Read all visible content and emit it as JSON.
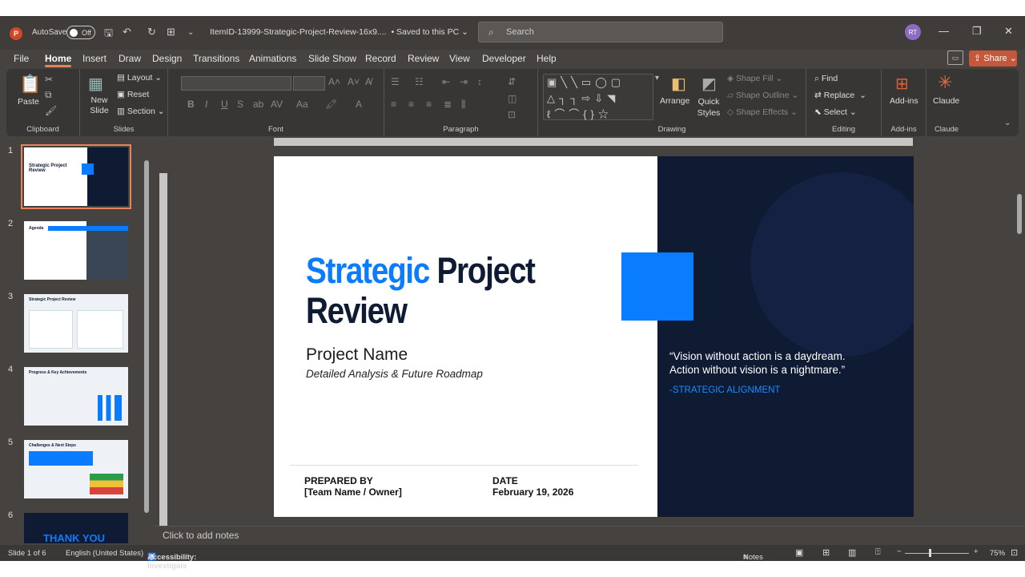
{
  "titlebar": {
    "autosave_label": "AutoSave",
    "autosave_state": "Off",
    "doc_title": "ItemID-13999-Strategic-Project-Review-16x9....",
    "save_status": "•  Saved to this PC",
    "search_placeholder": "Search",
    "user_initials": "RT"
  },
  "tabs": [
    "File",
    "Home",
    "Insert",
    "Draw",
    "Design",
    "Transitions",
    "Animations",
    "Slide Show",
    "Record",
    "Review",
    "View",
    "Developer",
    "Help"
  ],
  "share_label": "Share",
  "ribbon": {
    "clipboard": {
      "paste": "Paste",
      "label": "Clipboard"
    },
    "slides": {
      "new_slide": "New Slide",
      "layout": "Layout",
      "reset": "Reset",
      "section": "Section",
      "label": "Slides"
    },
    "font": {
      "label": "Font"
    },
    "paragraph": {
      "label": "Paragraph"
    },
    "drawing": {
      "arrange": "Arrange",
      "quick_styles": "Quick Styles",
      "shape_fill": "Shape Fill",
      "shape_outline": "Shape Outline",
      "shape_effects": "Shape Effects",
      "label": "Drawing"
    },
    "editing": {
      "find": "Find",
      "replace": "Replace",
      "select": "Select",
      "label": "Editing"
    },
    "addins": {
      "addins": "Add-ins",
      "label": "Add-ins"
    },
    "claude": {
      "claude": "Claude",
      "label": "Claude"
    }
  },
  "thumbnails": [
    {
      "num": "1",
      "title": "Strategic Project Review"
    },
    {
      "num": "2",
      "title": "Agenda"
    },
    {
      "num": "3",
      "title": "Strategic Project Review"
    },
    {
      "num": "4",
      "title": "Progress & Key Achievements"
    },
    {
      "num": "5",
      "title": "Challenges & Next Steps"
    },
    {
      "num": "6",
      "title": "THANK YOU"
    }
  ],
  "slide": {
    "title_blue": "Strategic",
    "title_dark_1": "Project",
    "title_dark_2": "Review",
    "project_name": "Project Name",
    "subtitle": "Detailed Analysis & Future Roadmap",
    "prepared_by_label": "PREPARED BY",
    "prepared_by_value": "[Team Name / Owner]",
    "date_label": "DATE",
    "date_value": "February 19, 2026",
    "quote_line1": "“Vision without action is a daydream.",
    "quote_line2": "Action without vision is a nightmare.”",
    "quote_attr": "-STRATEGIC ALIGNMENT",
    "accent_color": "#0a7cff",
    "dark_color": "#0f1a33"
  },
  "notes_placeholder": "Click to add notes",
  "status": {
    "slide_info": "Slide 1 of 6",
    "language": "English (United States)",
    "accessibility": "Accessibility: Investigate",
    "notes": "Notes",
    "zoom": "75%"
  }
}
